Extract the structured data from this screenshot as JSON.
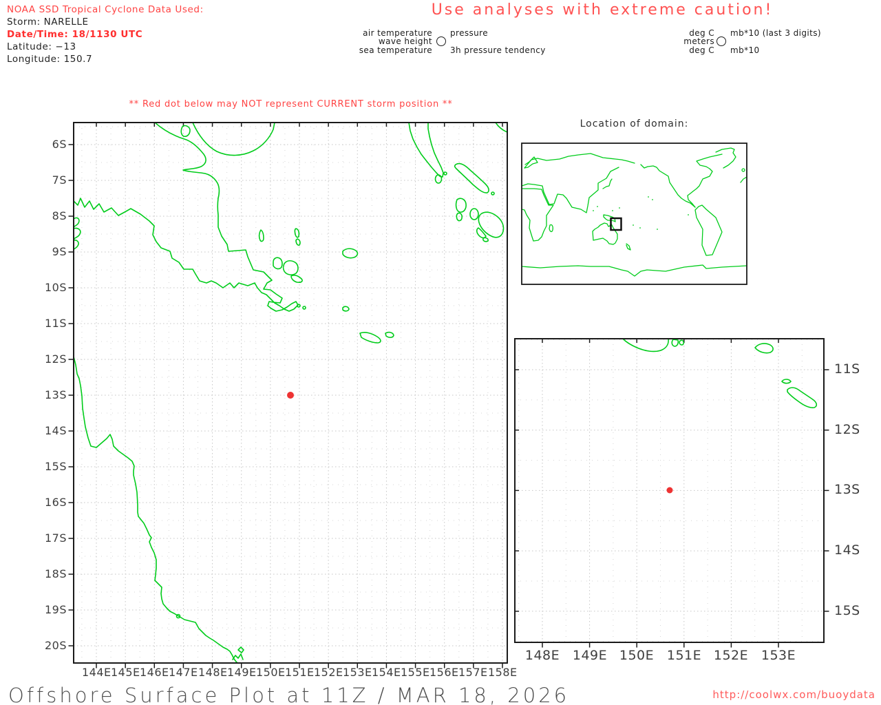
{
  "colors": {
    "accent_red": "#ff4343",
    "strong_red": "#ff2e2e",
    "coast_green": "#00cc1a",
    "storm_dot_red": "#ee3333",
    "grid_gray": "#c5c5c5",
    "axis_text": "#3e3e3e"
  },
  "header": {
    "data_source_line": "NOAA SSD Tropical Cyclone Data Used:",
    "storm_line": "Storm: NARELLE",
    "datetime_line": "Date/Time: 18/1130 UTC",
    "latitude_line": "Latitude: −13",
    "longitude_line": "Longitude: 150.7",
    "caution": "Use analyses with extreme caution!"
  },
  "station_model_legend": {
    "air_temperature": "air temperature",
    "wave_height": "wave height",
    "sea_temperature": "sea temperature",
    "pressure": "pressure",
    "pressure_tendency": "3h pressure tendency",
    "circle_icon": "station-circle-icon"
  },
  "units_legend": {
    "deg_c_top": "deg C",
    "meters": "meters",
    "deg_c_bottom": "deg C",
    "mb10_top": "mb*10 (last 3 digits)",
    "mb10_bottom": "mb*10",
    "circle_icon": "station-circle-icon"
  },
  "warning": "** Red dot below may NOT represent CURRENT storm position **",
  "inset": {
    "title": "Location of domain:"
  },
  "main_map": {
    "x_tick_labels": [
      "144E",
      "145E",
      "146E",
      "147E",
      "148E",
      "149E",
      "150E",
      "151E",
      "152E",
      "153E",
      "154E",
      "155E",
      "156E",
      "157E",
      "158E"
    ],
    "y_tick_labels": [
      "6S",
      "7S",
      "8S",
      "9S",
      "10S",
      "11S",
      "12S",
      "13S",
      "14S",
      "15S",
      "16S",
      "17S",
      "18S",
      "19S",
      "20S"
    ]
  },
  "detail_map": {
    "x_tick_labels": [
      "148E",
      "149E",
      "150E",
      "151E",
      "152E",
      "153E"
    ],
    "y_tick_labels": [
      "11S",
      "12S",
      "13S",
      "14S",
      "15S"
    ]
  },
  "storm": {
    "name": "NARELLE",
    "latitude": -13,
    "longitude": 150.7
  },
  "footer": {
    "title": "Offshore Surface Plot at 11Z / MAR 18, 2026",
    "url": "http://coolwx.com/buoydata"
  }
}
